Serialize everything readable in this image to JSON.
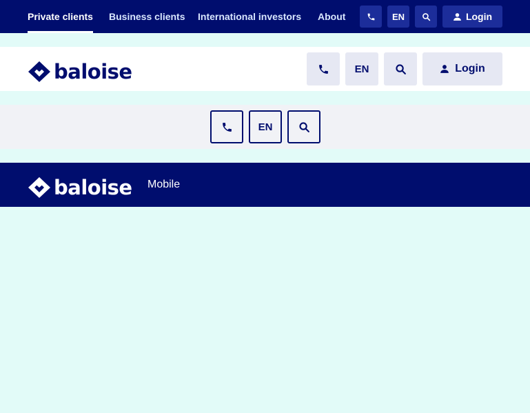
{
  "topnav": {
    "links": [
      "Private clients",
      "Business clients",
      "International investors",
      "About"
    ],
    "lang": "EN",
    "login": "Login"
  },
  "header": {
    "logo_text": "baloise",
    "lang": "EN",
    "login": "Login"
  },
  "greybar": {
    "lang": "EN"
  },
  "mobilebar": {
    "logo_text": "baloise",
    "caption": "Mobile"
  },
  "colors": {
    "brand_navy": "#000d6e",
    "button_blue": "#1c2d9a",
    "page_bg": "#e2fbf8",
    "grey_bg": "#f1f2f6",
    "light_button": "#e6e8f3"
  },
  "icons": [
    "phone-icon",
    "search-icon",
    "user-icon",
    "baloise-logo-diamond"
  ]
}
